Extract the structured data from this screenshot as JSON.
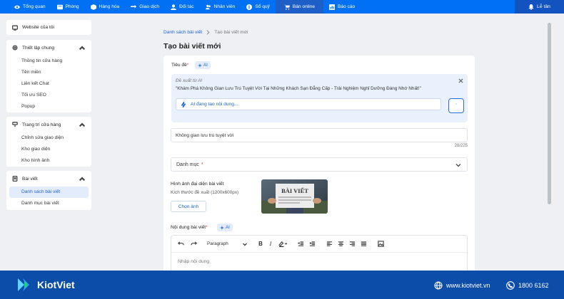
{
  "topnav": {
    "items": [
      {
        "label": "Tổng quan",
        "icon": "eye-icon"
      },
      {
        "label": "Phòng",
        "icon": "grid-icon"
      },
      {
        "label": "Hàng hóa",
        "icon": "box-icon"
      },
      {
        "label": "Giao dịch",
        "icon": "transfer-icon"
      },
      {
        "label": "Đối tác",
        "icon": "person-icon"
      },
      {
        "label": "Nhân viên",
        "icon": "users-icon"
      },
      {
        "label": "Sổ quỹ",
        "icon": "coin-icon"
      },
      {
        "label": "Bán online",
        "icon": "cart-icon",
        "active": true
      },
      {
        "label": "Báo cáo",
        "icon": "chart-icon"
      }
    ],
    "reception_label": "Lễ tân"
  },
  "sidebar": {
    "website_label": "Website của tôi",
    "general": {
      "title": "Thiết lập chung",
      "items": [
        "Thông tin cửa hàng",
        "Tên miền",
        "Liên kết Chat",
        "Tối ưu SEO",
        "Popup"
      ]
    },
    "store_design": {
      "title": "Trang trí cửa hàng",
      "items": [
        "Chỉnh sửa giao diện",
        "Kho giao diện",
        "Kho hình ảnh"
      ]
    },
    "posts": {
      "title": "Bài viết",
      "items": [
        "Danh sách bài viết",
        "Danh mục bài viết"
      ],
      "active_index": 0
    }
  },
  "breadcrumb": {
    "parent": "Danh sách bài viết",
    "current": "Tạo bài viết mới"
  },
  "page_title": "Tạo bài viết mới",
  "form": {
    "title_label": "Tiêu đề",
    "ai_label": "AI",
    "suggestion_heading": "Đề xuất từ AI",
    "suggestion_text": "\"Khám Phá Không Gian Lưu Trú Tuyệt Vời Tại Những Khách Sạn Đẳng Cấp - Trải Nghiệm Nghỉ Dưỡng Đáng Nhớ Nhất!\"",
    "generating_text": "AI đang tạo nội dung...",
    "send_glyph": "'",
    "title_value": "Không gian lưu trú tuyệt vời",
    "char_count": "28/225",
    "category_placeholder": "Danh mục",
    "image_label": "Hình ảnh đại diện bài viết",
    "image_hint": "Kích thước đề xuất (1200x600px)",
    "choose_image_label": "Chọn ảnh",
    "image_caption": "BÀI VIẾT",
    "content_label": "Nội dung bài viết",
    "editor": {
      "paragraph_label": "Paragraph",
      "placeholder": "Nhập nội dung"
    }
  },
  "footer": {
    "brand": "KiotViet",
    "website": "www.kiotviet.vn",
    "phone": "1800 6162"
  },
  "colors": {
    "primary": "#0070f4",
    "footer": "#0b4da8",
    "accent": "#1a63d6"
  }
}
